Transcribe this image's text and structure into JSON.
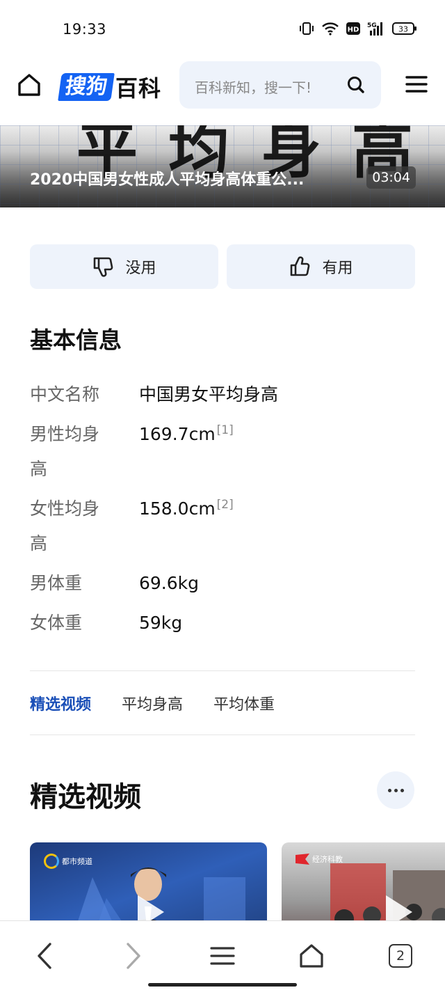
{
  "status_bar": {
    "time": "19:33",
    "network": "5G",
    "hd": "HD",
    "battery": "33"
  },
  "header": {
    "logo_badge": "搜狗",
    "logo_text": "百科",
    "search_placeholder": "百科新知，搜一下!"
  },
  "video_banner": {
    "background_text": "平均身高",
    "title": "2020中国男女性成人平均身高体重公...",
    "duration": "03:04"
  },
  "feedback": {
    "useless_label": "没用",
    "useful_label": "有用"
  },
  "basic_info": {
    "title": "基本信息",
    "rows": [
      {
        "key": "中文名称",
        "value": "中国男女平均身高",
        "ref": ""
      },
      {
        "key": "男性均身高",
        "value": "169.7cm",
        "ref": "[1]"
      },
      {
        "key": "女性均身高",
        "value": "158.0cm",
        "ref": "[2]"
      },
      {
        "key": "男体重",
        "value": "69.6kg",
        "ref": ""
      },
      {
        "key": "女体重",
        "value": "59kg",
        "ref": ""
      }
    ]
  },
  "tabs": [
    {
      "label": "精选视频",
      "active": true
    },
    {
      "label": "平均身高",
      "active": false
    },
    {
      "label": "平均体重",
      "active": false
    }
  ],
  "featured_video": {
    "title": "精选视频",
    "thumb1_channel": "都市频道",
    "thumb2_channel": "经济科教"
  },
  "bottom_nav": {
    "tab_count": "2"
  },
  "colors": {
    "brand_blue": "#1463f3",
    "active_tab": "#1a4fb7",
    "button_bg": "#eef3fb"
  }
}
